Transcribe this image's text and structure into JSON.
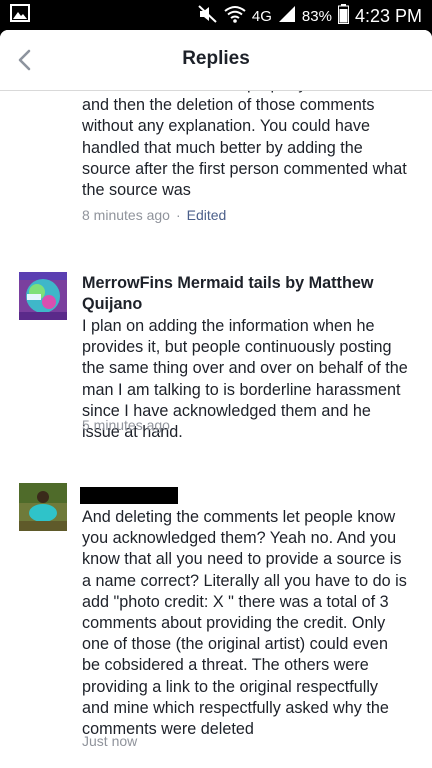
{
  "status_bar": {
    "network": "4G",
    "battery": "83%",
    "time": "4:23 PM"
  },
  "header": {
    "title": "Replies"
  },
  "comments": [
    {
      "author": "",
      "text": "use of someone else's property without credit and then the deletion of those comments without any explanation. You could have handled that much better by adding the source after the first person commented what the source was",
      "time": "8 minutes ago",
      "separator": "·",
      "edited": "Edited"
    },
    {
      "author": "MerrowFins Mermaid tails by Matthew Quijano",
      "text": "I plan on adding the information when he provides it, but people continuously posting the same thing over and over on behalf of the man I am talking to is borderline harassment since I have acknowledged them and he issue at hand.",
      "time": "5 minutes ago"
    },
    {
      "author": "",
      "text": "And deleting the comments let people know you acknowledged them? Yeah no. And you know that all you need to provide a source is a name correct? Literally all you have to do is add \"photo credit: X \" there was a total of 3 comments about providing the credit. Only one of those (the original artist) could even be cobsidered a threat. The others were providing a link to the original respectfully and mine which respectfully asked why the comments were deleted",
      "time": "Just now"
    }
  ]
}
